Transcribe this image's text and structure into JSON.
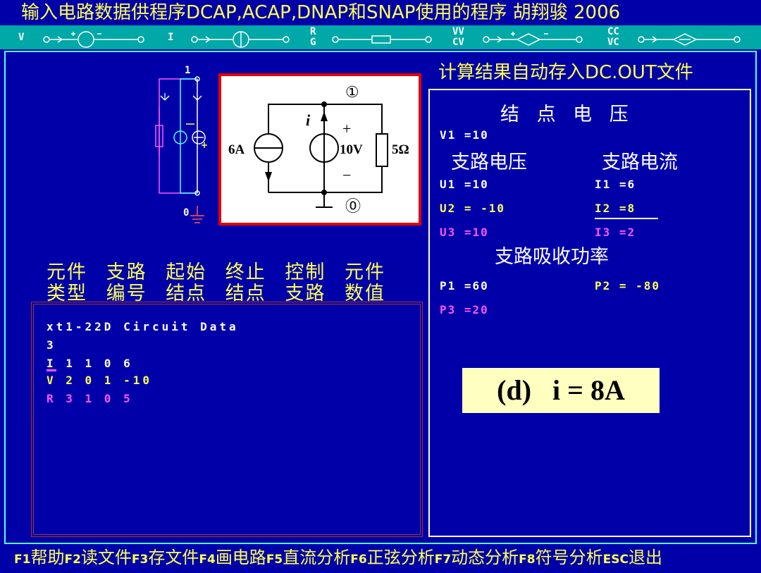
{
  "title_bar": {
    "text": "输入电路数据供程序DCAP,ACAP,DNAP和SNAP使用的程序  胡翔骏 2006"
  },
  "toolbar": {
    "v_label": "V",
    "i_label": "I",
    "r_label": "R",
    "g_label": "G",
    "vv_label": "VV",
    "cv_label": "CV",
    "cc_label": "CC",
    "vc_label": "VC"
  },
  "results": {
    "caption": "计算结果自动存入DC.OUT文件",
    "node_voltage_title": "结 点 电 压",
    "node_voltages": [
      "V1 =10"
    ],
    "branch_voltage_title": "支路电压",
    "branch_current_title": "支路电流",
    "branch_voltages": [
      "U1 =10",
      "U2 = -10",
      "U3 =10"
    ],
    "branch_currents": [
      "I1 =6",
      "I2 =8",
      "I3 =2"
    ],
    "power_title": "支路吸收功率",
    "powers": [
      "P1 =60",
      "P2 = -80",
      "P3 =20"
    ]
  },
  "schematic_left": {
    "node_top": "1",
    "node_bottom": "0"
  },
  "circuit_figure": {
    "node_top": "①",
    "node_bottom": "⓪",
    "current_label": "i",
    "plus": "+",
    "minus": "−",
    "current_source": "6A",
    "voltage_source": "10V",
    "resistor": "5Ω"
  },
  "columns": {
    "row1": [
      "元件",
      "支路",
      "起始",
      "终止",
      "控制",
      "元件"
    ],
    "row2": [
      "类型",
      "编号",
      "结点",
      "结点",
      "支路",
      "数值"
    ]
  },
  "circuit_data": {
    "title": "xt1-22D  Circuit Data",
    "count": "3",
    "lines": [
      "I 1 1 0 6",
      "V 2 0 1 -10",
      "R 3 1 0 5"
    ]
  },
  "answer_label": "(d)   i = 8A",
  "status_bar": {
    "items": [
      {
        "key": "F1",
        "label": "帮助"
      },
      {
        "key": "F2",
        "label": "读文件"
      },
      {
        "key": "F3",
        "label": "存文件"
      },
      {
        "key": "F4",
        "label": "画电路"
      },
      {
        "key": "F5",
        "label": "直流分析"
      },
      {
        "key": "F6",
        "label": "正弦分析"
      },
      {
        "key": "F7",
        "label": "动态分析"
      },
      {
        "key": "F8",
        "label": "符号分析"
      },
      {
        "key": "ESC",
        "label": "退出"
      }
    ]
  },
  "colors": {
    "background": "#0000a8",
    "toolbar": "#00a8a8",
    "highlight_yellow": "#ffff55",
    "magenta": "#ff55ff",
    "frame_red": "#e00000"
  }
}
